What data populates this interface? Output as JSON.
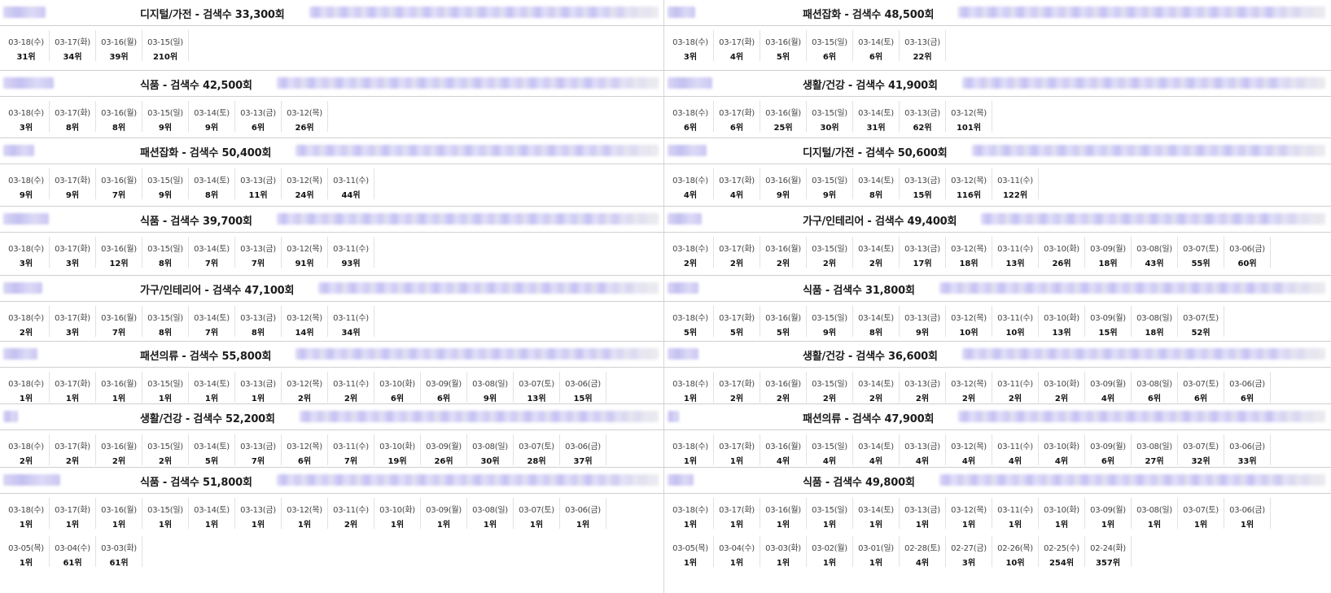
{
  "columns": [
    {
      "panels": [
        {
          "title": "디지털/가전 - 검색수 33,300회",
          "rows": [
            [
              [
                "03-18(수)",
                "31위"
              ],
              [
                "03-17(화)",
                "34위"
              ],
              [
                "03-16(월)",
                "39위"
              ],
              [
                "03-15(일)",
                "210위"
              ]
            ]
          ]
        },
        {
          "title": "식품 - 검색수 42,500회",
          "rows": [
            [
              [
                "03-18(수)",
                "3위"
              ],
              [
                "03-17(화)",
                "8위"
              ],
              [
                "03-16(월)",
                "8위"
              ],
              [
                "03-15(일)",
                "9위"
              ],
              [
                "03-14(토)",
                "9위"
              ],
              [
                "03-13(금)",
                "6위"
              ],
              [
                "03-12(목)",
                "26위"
              ]
            ]
          ]
        },
        {
          "title": "패션잡화 - 검색수 50,400회",
          "rows": [
            [
              [
                "03-18(수)",
                "9위"
              ],
              [
                "03-17(화)",
                "9위"
              ],
              [
                "03-16(월)",
                "7위"
              ],
              [
                "03-15(일)",
                "9위"
              ],
              [
                "03-14(토)",
                "8위"
              ],
              [
                "03-13(금)",
                "11위"
              ],
              [
                "03-12(목)",
                "24위"
              ],
              [
                "03-11(수)",
                "44위"
              ]
            ]
          ]
        },
        {
          "title": "식품 - 검색수 39,700회",
          "rows": [
            [
              [
                "03-18(수)",
                "3위"
              ],
              [
                "03-17(화)",
                "3위"
              ],
              [
                "03-16(월)",
                "12위"
              ],
              [
                "03-15(일)",
                "8위"
              ],
              [
                "03-14(토)",
                "7위"
              ],
              [
                "03-13(금)",
                "7위"
              ],
              [
                "03-12(목)",
                "91위"
              ],
              [
                "03-11(수)",
                "93위"
              ]
            ]
          ]
        },
        {
          "title": "가구/인테리어 - 검색수 47,100회",
          "rows": [
            [
              [
                "03-18(수)",
                "2위"
              ],
              [
                "03-17(화)",
                "3위"
              ],
              [
                "03-16(월)",
                "7위"
              ],
              [
                "03-15(일)",
                "8위"
              ],
              [
                "03-14(토)",
                "7위"
              ],
              [
                "03-13(금)",
                "8위"
              ],
              [
                "03-12(목)",
                "14위"
              ],
              [
                "03-11(수)",
                "34위"
              ]
            ]
          ]
        },
        {
          "title": "패션의류 - 검색수 55,800회",
          "rows": [
            [
              [
                "03-18(수)",
                "1위"
              ],
              [
                "03-17(화)",
                "1위"
              ],
              [
                "03-16(월)",
                "1위"
              ],
              [
                "03-15(일)",
                "1위"
              ],
              [
                "03-14(토)",
                "1위"
              ],
              [
                "03-13(금)",
                "1위"
              ],
              [
                "03-12(목)",
                "2위"
              ],
              [
                "03-11(수)",
                "2위"
              ],
              [
                "03-10(화)",
                "6위"
              ],
              [
                "03-09(월)",
                "6위"
              ],
              [
                "03-08(일)",
                "9위"
              ],
              [
                "03-07(토)",
                "13위"
              ],
              [
                "03-06(금)",
                "15위"
              ]
            ]
          ]
        },
        {
          "title": "생활/건강 - 검색수 52,200회",
          "rows": [
            [
              [
                "03-18(수)",
                "2위"
              ],
              [
                "03-17(화)",
                "2위"
              ],
              [
                "03-16(월)",
                "2위"
              ],
              [
                "03-15(일)",
                "2위"
              ],
              [
                "03-14(토)",
                "5위"
              ],
              [
                "03-13(금)",
                "7위"
              ],
              [
                "03-12(목)",
                "6위"
              ],
              [
                "03-11(수)",
                "7위"
              ],
              [
                "03-10(화)",
                "19위"
              ],
              [
                "03-09(월)",
                "26위"
              ],
              [
                "03-08(일)",
                "30위"
              ],
              [
                "03-07(토)",
                "28위"
              ],
              [
                "03-06(금)",
                "37위"
              ]
            ]
          ]
        },
        {
          "title": "식품 - 검색수 51,800회",
          "rows": [
            [
              [
                "03-18(수)",
                "1위"
              ],
              [
                "03-17(화)",
                "1위"
              ],
              [
                "03-16(월)",
                "1위"
              ],
              [
                "03-15(일)",
                "1위"
              ],
              [
                "03-14(토)",
                "1위"
              ],
              [
                "03-13(금)",
                "1위"
              ],
              [
                "03-12(목)",
                "1위"
              ],
              [
                "03-11(수)",
                "2위"
              ],
              [
                "03-10(화)",
                "1위"
              ],
              [
                "03-09(월)",
                "1위"
              ],
              [
                "03-08(일)",
                "1위"
              ],
              [
                "03-07(토)",
                "1위"
              ],
              [
                "03-06(금)",
                "1위"
              ]
            ],
            [
              [
                "03-05(목)",
                "1위"
              ],
              [
                "03-04(수)",
                "61위"
              ],
              [
                "03-03(화)",
                "61위"
              ]
            ]
          ]
        }
      ]
    },
    {
      "panels": [
        {
          "title": "패션잡화 - 검색수 48,500회",
          "rows": [
            [
              [
                "03-18(수)",
                "3위"
              ],
              [
                "03-17(화)",
                "4위"
              ],
              [
                "03-16(월)",
                "5위"
              ],
              [
                "03-15(일)",
                "6위"
              ],
              [
                "03-14(토)",
                "6위"
              ],
              [
                "03-13(금)",
                "22위"
              ]
            ]
          ]
        },
        {
          "title": "생활/건강 - 검색수 41,900회",
          "rows": [
            [
              [
                "03-18(수)",
                "6위"
              ],
              [
                "03-17(화)",
                "6위"
              ],
              [
                "03-16(월)",
                "25위"
              ],
              [
                "03-15(일)",
                "30위"
              ],
              [
                "03-14(토)",
                "31위"
              ],
              [
                "03-13(금)",
                "62위"
              ],
              [
                "03-12(목)",
                "101위"
              ]
            ]
          ]
        },
        {
          "title": "디지털/가전 - 검색수 50,600회",
          "rows": [
            [
              [
                "03-18(수)",
                "4위"
              ],
              [
                "03-17(화)",
                "4위"
              ],
              [
                "03-16(월)",
                "9위"
              ],
              [
                "03-15(일)",
                "9위"
              ],
              [
                "03-14(토)",
                "8위"
              ],
              [
                "03-13(금)",
                "15위"
              ],
              [
                "03-12(목)",
                "116위"
              ],
              [
                "03-11(수)",
                "122위"
              ]
            ]
          ]
        },
        {
          "title": "가구/인테리어 - 검색수 49,400회",
          "rows": [
            [
              [
                "03-18(수)",
                "2위"
              ],
              [
                "03-17(화)",
                "2위"
              ],
              [
                "03-16(월)",
                "2위"
              ],
              [
                "03-15(일)",
                "2위"
              ],
              [
                "03-14(토)",
                "2위"
              ],
              [
                "03-13(금)",
                "17위"
              ],
              [
                "03-12(목)",
                "18위"
              ],
              [
                "03-11(수)",
                "13위"
              ],
              [
                "03-10(화)",
                "26위"
              ],
              [
                "03-09(월)",
                "18위"
              ],
              [
                "03-08(일)",
                "43위"
              ],
              [
                "03-07(토)",
                "55위"
              ],
              [
                "03-06(금)",
                "60위"
              ]
            ]
          ]
        },
        {
          "title": "식품 - 검색수 31,800회",
          "rows": [
            [
              [
                "03-18(수)",
                "5위"
              ],
              [
                "03-17(화)",
                "5위"
              ],
              [
                "03-16(월)",
                "5위"
              ],
              [
                "03-15(일)",
                "9위"
              ],
              [
                "03-14(토)",
                "8위"
              ],
              [
                "03-13(금)",
                "9위"
              ],
              [
                "03-12(목)",
                "10위"
              ],
              [
                "03-11(수)",
                "10위"
              ],
              [
                "03-10(화)",
                "13위"
              ],
              [
                "03-09(월)",
                "15위"
              ],
              [
                "03-08(일)",
                "18위"
              ],
              [
                "03-07(토)",
                "52위"
              ]
            ]
          ]
        },
        {
          "title": "생활/건강 - 검색수 36,600회",
          "rows": [
            [
              [
                "03-18(수)",
                "1위"
              ],
              [
                "03-17(화)",
                "2위"
              ],
              [
                "03-16(월)",
                "2위"
              ],
              [
                "03-15(일)",
                "2위"
              ],
              [
                "03-14(토)",
                "2위"
              ],
              [
                "03-13(금)",
                "2위"
              ],
              [
                "03-12(목)",
                "2위"
              ],
              [
                "03-11(수)",
                "2위"
              ],
              [
                "03-10(화)",
                "2위"
              ],
              [
                "03-09(월)",
                "4위"
              ],
              [
                "03-08(일)",
                "6위"
              ],
              [
                "03-07(토)",
                "6위"
              ],
              [
                "03-06(금)",
                "6위"
              ]
            ]
          ]
        },
        {
          "title": "패션의류 - 검색수 47,900회",
          "rows": [
            [
              [
                "03-18(수)",
                "1위"
              ],
              [
                "03-17(화)",
                "1위"
              ],
              [
                "03-16(월)",
                "4위"
              ],
              [
                "03-15(일)",
                "4위"
              ],
              [
                "03-14(토)",
                "4위"
              ],
              [
                "03-13(금)",
                "4위"
              ],
              [
                "03-12(목)",
                "4위"
              ],
              [
                "03-11(수)",
                "4위"
              ],
              [
                "03-10(화)",
                "4위"
              ],
              [
                "03-09(월)",
                "6위"
              ],
              [
                "03-08(일)",
                "27위"
              ],
              [
                "03-07(토)",
                "32위"
              ],
              [
                "03-06(금)",
                "33위"
              ]
            ]
          ]
        },
        {
          "title": "식품 - 검색수 49,800회",
          "rows": [
            [
              [
                "03-18(수)",
                "1위"
              ],
              [
                "03-17(화)",
                "1위"
              ],
              [
                "03-16(월)",
                "1위"
              ],
              [
                "03-15(일)",
                "1위"
              ],
              [
                "03-14(토)",
                "1위"
              ],
              [
                "03-13(금)",
                "1위"
              ],
              [
                "03-12(목)",
                "1위"
              ],
              [
                "03-11(수)",
                "1위"
              ],
              [
                "03-10(화)",
                "1위"
              ],
              [
                "03-09(월)",
                "1위"
              ],
              [
                "03-08(일)",
                "1위"
              ],
              [
                "03-07(토)",
                "1위"
              ],
              [
                "03-06(금)",
                "1위"
              ]
            ],
            [
              [
                "03-05(목)",
                "1위"
              ],
              [
                "03-04(수)",
                "1위"
              ],
              [
                "03-03(화)",
                "1위"
              ],
              [
                "03-02(월)",
                "1위"
              ],
              [
                "03-01(일)",
                "1위"
              ],
              [
                "02-28(토)",
                "4위"
              ],
              [
                "02-27(금)",
                "3위"
              ],
              [
                "02-26(목)",
                "10위"
              ],
              [
                "02-25(수)",
                "254위"
              ],
              [
                "02-24(화)",
                "357위"
              ]
            ]
          ]
        }
      ]
    }
  ]
}
